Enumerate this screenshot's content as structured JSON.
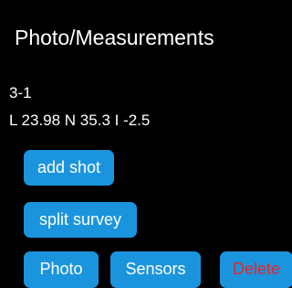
{
  "dialog": {
    "title": "Photo/Measurements",
    "shot_name": "3-1",
    "shot_data": "L 23.98 N 35.3 I -2.5"
  },
  "buttons": {
    "add_shot": "add shot",
    "split_survey": "split survey",
    "photo": "Photo",
    "sensors": "Sensors",
    "delete": "Delete"
  },
  "colors": {
    "background": "#000000",
    "button": "#1a95dd",
    "text": "#ffffff",
    "delete_text": "#e8242a"
  }
}
